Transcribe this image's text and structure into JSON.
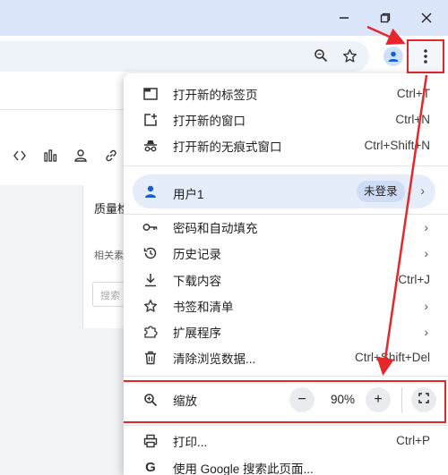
{
  "window": {
    "minimize_icon": "minimize-icon",
    "restore_icon": "restore-icon",
    "close_icon": "close-icon"
  },
  "toolbar": {
    "icons": [
      "search-icon",
      "star-icon",
      "profile-icon",
      "more-vert-icon"
    ]
  },
  "page": {
    "panel_title": "质量检",
    "panel_label": "相关素",
    "panel_input_placeholder": "搜索"
  },
  "menu": {
    "new_tab": {
      "label": "打开新的标签页",
      "shortcut": "Ctrl+T"
    },
    "new_window": {
      "label": "打开新的窗口",
      "shortcut": "Ctrl+N"
    },
    "incognito": {
      "label": "打开新的无痕式窗口",
      "shortcut": "Ctrl+Shift+N"
    },
    "profile": {
      "name": "用户1",
      "badge": "未登录"
    },
    "passwords": {
      "label": "密码和自动填充"
    },
    "history": {
      "label": "历史记录"
    },
    "downloads": {
      "label": "下载内容",
      "shortcut": "Ctrl+J"
    },
    "bookmarks": {
      "label": "书签和清单"
    },
    "extensions": {
      "label": "扩展程序"
    },
    "clear_data": {
      "label": "清除浏览数据...",
      "shortcut": "Ctrl+Shift+Del"
    },
    "zoom": {
      "label": "缩放",
      "minus": "−",
      "value": "90%",
      "plus": "+"
    },
    "print": {
      "label": "打印...",
      "shortcut": "Ctrl+P"
    },
    "google_search": {
      "label": "使用 Google 搜索此页面..."
    }
  },
  "colors": {
    "annotation": "#e5262a",
    "titlebar": "#dbe6fb",
    "profile_highlight": "#e5ecfa"
  }
}
